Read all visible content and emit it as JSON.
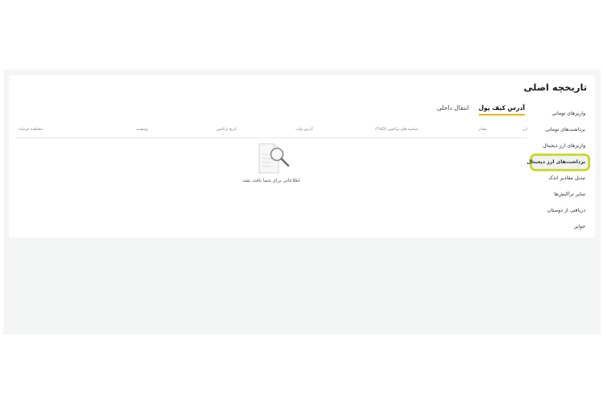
{
  "page": {
    "title": "تاریخچه اصلی"
  },
  "sidebar": {
    "items": [
      {
        "label": "واریزهای تومانی"
      },
      {
        "label": "برداشت‌های تومانی"
      },
      {
        "label": "واریزهای ارز دیجیتال"
      },
      {
        "label": "برداشت‌های ارز دیجیتال",
        "active": true
      },
      {
        "label": "تبدیل مقادیر اندک"
      },
      {
        "label": "سایر تراکنش‌ها"
      },
      {
        "label": "دریافتی از دوستان"
      },
      {
        "label": "جوایز"
      }
    ],
    "active_color": "#c9d93a"
  },
  "tabs": [
    {
      "label": "آدرس کیف پول",
      "active": true
    },
    {
      "label": "انتقال داخلی",
      "active": false
    }
  ],
  "tab_accent": "#e2b71f",
  "table": {
    "columns": [
      "ارز",
      "مقدار",
      "شناسه های تراکنش (TxID)",
      "آدرس ولت",
      "تاریخ تراکنش",
      "وضعیت",
      "مشاهده جزئیات"
    ]
  },
  "empty_state": {
    "icon": "document-search-icon",
    "message": "اطلاعاتی برای شما یافت نشد"
  }
}
